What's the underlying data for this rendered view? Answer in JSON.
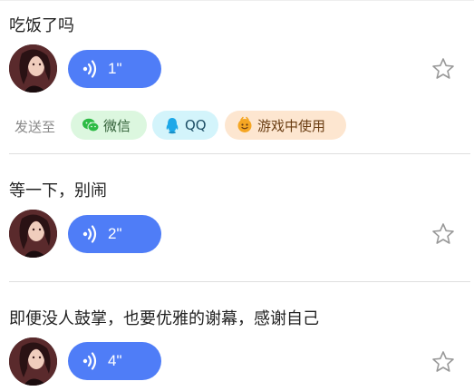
{
  "items": [
    {
      "text": "吃饭了吗",
      "duration": "1\""
    },
    {
      "text": "等一下，别闹",
      "duration": "2\""
    },
    {
      "text": "即便没人鼓掌，也要优雅的谢幕，感谢自己",
      "duration": "4\""
    }
  ],
  "send_to": {
    "label": "发送至",
    "options": [
      {
        "label": "微信",
        "icon": "wechat-icon"
      },
      {
        "label": "QQ",
        "icon": "qq-icon"
      },
      {
        "label": "游戏中使用",
        "icon": "game-icon"
      }
    ]
  },
  "colors": {
    "voice_button": "#4f7df7",
    "wechat_chip": "#dcf7df",
    "qq_chip": "#d3f4fb",
    "game_chip": "#fde6d0"
  }
}
